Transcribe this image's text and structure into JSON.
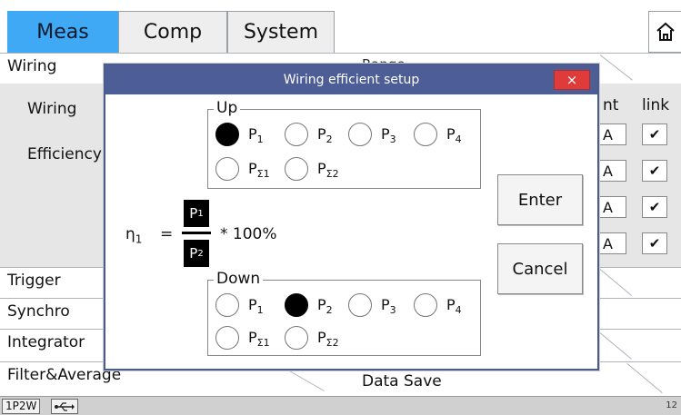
{
  "tabs": {
    "meas": "Meas",
    "comp": "Comp",
    "system": "System"
  },
  "sections": {
    "wiring": "Wiring",
    "trigger": "Trigger",
    "synchro": "Synchro",
    "integrator": "Integrator",
    "filter_average": "Filter&Average",
    "data_save": "Data Save",
    "second_right": "Range"
  },
  "panel": {
    "wiring_label": "Wiring",
    "efficiency_label": "Efficiency",
    "col_current_partial": "nt",
    "col_link": "link",
    "rows": [
      {
        "unit": "A",
        "check": "✔"
      },
      {
        "unit": "A",
        "check": "✔"
      },
      {
        "unit": "A",
        "check": "✔"
      },
      {
        "unit": "A",
        "check": "✔"
      }
    ]
  },
  "dialog": {
    "title": "Wiring efficient setup",
    "close": "×",
    "up_legend": "Up",
    "down_legend": "Down",
    "up_selected": "P1",
    "down_selected": "P2",
    "enter": "Enter",
    "cancel": "Cancel",
    "eta_main": "η",
    "eta_sub": "1",
    "equals": "=",
    "numerator_main": "P",
    "numerator_sub": "1",
    "denominator_main": "P",
    "denominator_sub": "2",
    "times": "* 100%",
    "options": {
      "p1": {
        "main": "P",
        "sub": "1"
      },
      "p2": {
        "main": "P",
        "sub": "2"
      },
      "p3": {
        "main": "P",
        "sub": "3"
      },
      "p4": {
        "main": "P",
        "sub": "4"
      },
      "ps1": {
        "main": "P",
        "sub": "Σ1"
      },
      "ps2": {
        "main": "P",
        "sub": "Σ2"
      }
    }
  },
  "status": {
    "wiring_mode": "1P2W",
    "usb_icon": "usb-icon",
    "page_num": "12"
  },
  "colors": {
    "active_tab": "#3fa9f5",
    "dialog_title": "#4d5d96",
    "close_button": "#e03b3b"
  }
}
